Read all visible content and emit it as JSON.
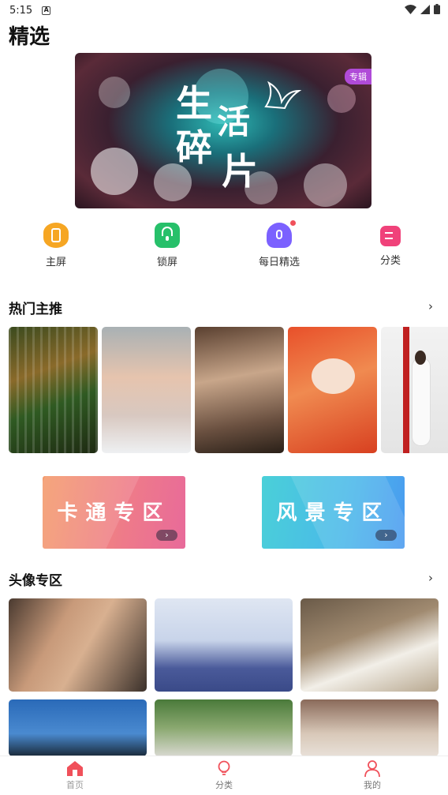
{
  "status_bar": {
    "time": "5:15",
    "notif_glyph": "A"
  },
  "header": {
    "title": "精选"
  },
  "banner": {
    "line1": "生",
    "line2": "活",
    "line3": "碎",
    "line4": "片",
    "badge": "专辑"
  },
  "quick_nav": [
    {
      "label": "主屏",
      "icon": "home-screen-icon",
      "color": "#f6a623"
    },
    {
      "label": "锁屏",
      "icon": "lock-icon",
      "color": "#27c06a"
    },
    {
      "label": "每日精选",
      "icon": "bell-icon",
      "color": "#7b61ff"
    },
    {
      "label": "分类",
      "icon": "category-icon",
      "color": "#f0427a"
    }
  ],
  "hot": {
    "title": "热门主推",
    "more": "›"
  },
  "zones": [
    {
      "label": "卡通专区",
      "arrow": "›"
    },
    {
      "label": "风景专区",
      "arrow": "›"
    }
  ],
  "avatars": {
    "title": "头像专区",
    "more": "›"
  },
  "tab_bar": [
    {
      "label": "首页",
      "icon": "home-icon",
      "active": true
    },
    {
      "label": "分类",
      "icon": "bulb-icon",
      "active": false
    },
    {
      "label": "我的",
      "icon": "user-icon",
      "active": false
    }
  ],
  "colors": {
    "accent": "#f0505a",
    "badge": "#b04bd8"
  }
}
